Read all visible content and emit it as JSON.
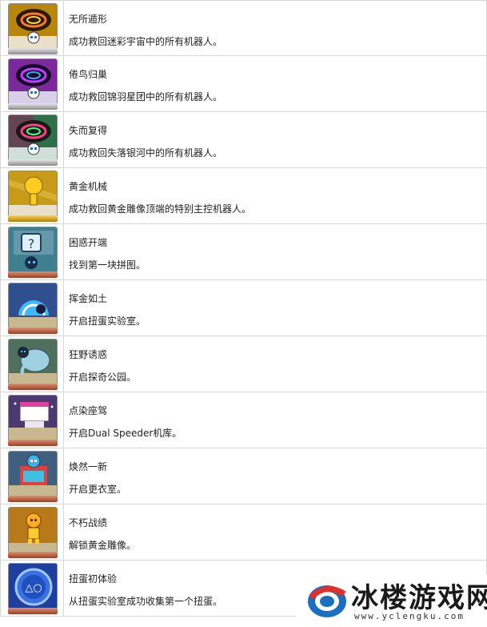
{
  "trophies": [
    {
      "title": "无所遁形",
      "desc": "成功救回迷彩宇宙中的所有机器人。",
      "tier": "silver",
      "icon": "rainbow-galaxy-icon",
      "bg": "#b8860b"
    },
    {
      "title": "倦鸟归巢",
      "desc": "成功救回锦羽星团中的所有机器人。",
      "tier": "silver",
      "icon": "purple-galaxy-icon",
      "bg": "#7a2a9a"
    },
    {
      "title": "失而复得",
      "desc": "成功救回失落银河中的所有机器人。",
      "tier": "silver",
      "icon": "lost-galaxy-icon",
      "bg": "#2f6f4a"
    },
    {
      "title": "黄金机械",
      "desc": "成功救回黄金雕像顶端的特别主控机器人。",
      "tier": "gold",
      "icon": "golden-robot-icon",
      "bg": "#c79a18"
    },
    {
      "title": "困惑开端",
      "desc": "找到第一块拼图。",
      "tier": "bronze",
      "icon": "puzzle-piece-icon",
      "bg": "#3f7f8f"
    },
    {
      "title": "挥金如土",
      "desc": "开启扭蛋实验室。",
      "tier": "bronze",
      "icon": "gacha-lab-icon",
      "bg": "#2f4f8f"
    },
    {
      "title": "狂野诱惑",
      "desc": "开启探奇公园。",
      "tier": "bronze",
      "icon": "park-elephant-icon",
      "bg": "#4f6f5f"
    },
    {
      "title": "点染座驾",
      "desc": "开启Dual Speeder机库。",
      "tier": "bronze",
      "icon": "hangar-icon",
      "bg": "#4a3a6f"
    },
    {
      "title": "焕然一新",
      "desc": "开启更衣室。",
      "tier": "bronze",
      "icon": "dressing-room-icon",
      "bg": "#3f5f7f"
    },
    {
      "title": "不朽战绩",
      "desc": "解锁黄金雕像。",
      "tier": "bronze",
      "icon": "golden-statue-icon",
      "bg": "#b87a18"
    },
    {
      "title": "扭蛋初体验",
      "desc": "从扭蛋实验室成功收集第一个扭蛋。",
      "tier": "bronze",
      "icon": "playstation-capsule-icon",
      "bg": "#1f3f9f"
    }
  ],
  "watermark": {
    "name": "冰楼游戏网",
    "url": "www.yclengku.com",
    "icon": "site-logo-icon",
    "brand_color": "#1a6fc0"
  }
}
